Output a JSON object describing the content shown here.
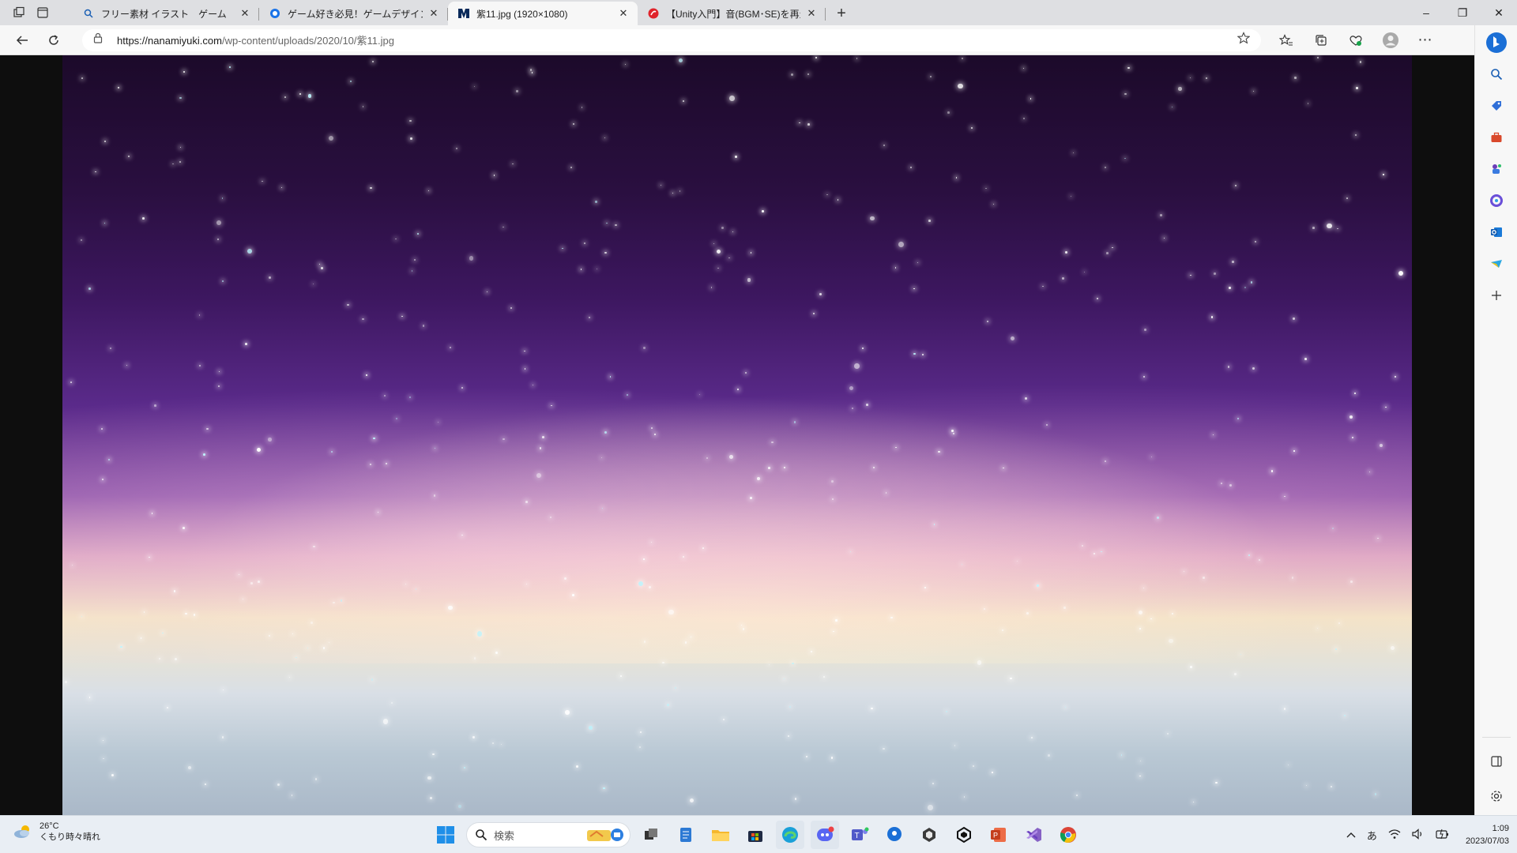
{
  "window": {
    "minimize": "–",
    "maximize": "❐",
    "close": "✕"
  },
  "tabs": [
    {
      "title": "フリー素材 イラスト　ゲーム　タイトル",
      "favicon": "search-icon",
      "active": false
    },
    {
      "title": "ゲーム好き必見！ゲームデザイン フリー",
      "favicon": "globe-icon",
      "active": false
    },
    {
      "title": "紫11.jpg (1920×1080)",
      "favicon": "site-logo-icon",
      "active": true
    },
    {
      "title": "【Unity入門】音(BGM･SE)を再生す",
      "favicon": "red-logo-icon",
      "active": false
    }
  ],
  "toolbar": {
    "url_host": "https://nanamiyuki.com",
    "url_path": "/wp-content/uploads/2020/10/紫11.jpg"
  },
  "taskbar": {
    "weather_temp": "26°C",
    "weather_text": "くもり時々晴れ",
    "search_placeholder": "検索",
    "ime": "あ",
    "time": "1:09",
    "date": "2023/07/03"
  },
  "colors": {
    "accent": "#0078d4",
    "sky_top": "#1c0a2a",
    "sky_mid": "#5a2a8a",
    "sky_glow": "#f3e6c6",
    "sky_bottom": "#aab8c8"
  }
}
